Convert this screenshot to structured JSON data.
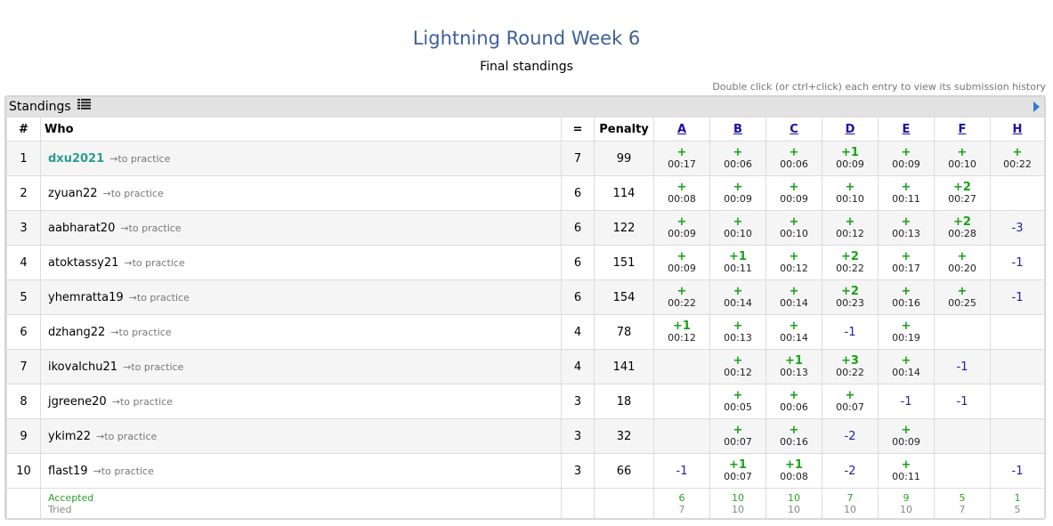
{
  "title": "Lightning Round Week 6",
  "subtitle": "Final standings",
  "hint": "Double click (or ctrl+click) each entry to view its submission history",
  "panel": {
    "label": "Standings",
    "icon": "list-icon",
    "expand_icon": "expand-arrow-icon"
  },
  "headers": {
    "rank": "#",
    "who": "Who",
    "solved": "=",
    "penalty": "Penalty"
  },
  "problems": [
    "A",
    "B",
    "C",
    "D",
    "E",
    "F",
    "H"
  ],
  "practice_label": "→to practice",
  "rows": [
    {
      "rank": "1",
      "user": "dxu2021",
      "solved": "7",
      "penalty": "99",
      "cells": [
        {
          "r": "+",
          "t": "00:17"
        },
        {
          "r": "+",
          "t": "00:06"
        },
        {
          "r": "+",
          "t": "00:06"
        },
        {
          "r": "+1",
          "t": "00:09"
        },
        {
          "r": "+",
          "t": "00:09"
        },
        {
          "r": "+",
          "t": "00:10"
        },
        {
          "r": "+",
          "t": "00:22"
        }
      ]
    },
    {
      "rank": "2",
      "user": "zyuan22",
      "solved": "6",
      "penalty": "114",
      "cells": [
        {
          "r": "+",
          "t": "00:08"
        },
        {
          "r": "+",
          "t": "00:09"
        },
        {
          "r": "+",
          "t": "00:09"
        },
        {
          "r": "+",
          "t": "00:10"
        },
        {
          "r": "+",
          "t": "00:11"
        },
        {
          "r": "+2",
          "t": "00:27"
        },
        {
          "r": "",
          "t": ""
        }
      ]
    },
    {
      "rank": "3",
      "user": "aabharat20",
      "solved": "6",
      "penalty": "122",
      "cells": [
        {
          "r": "+",
          "t": "00:09"
        },
        {
          "r": "+",
          "t": "00:10"
        },
        {
          "r": "+",
          "t": "00:10"
        },
        {
          "r": "+",
          "t": "00:12"
        },
        {
          "r": "+",
          "t": "00:13"
        },
        {
          "r": "+2",
          "t": "00:28"
        },
        {
          "r": "-3",
          "t": ""
        }
      ]
    },
    {
      "rank": "4",
      "user": "atoktassy21",
      "solved": "6",
      "penalty": "151",
      "cells": [
        {
          "r": "+",
          "t": "00:09"
        },
        {
          "r": "+1",
          "t": "00:11"
        },
        {
          "r": "+",
          "t": "00:12"
        },
        {
          "r": "+2",
          "t": "00:22"
        },
        {
          "r": "+",
          "t": "00:17"
        },
        {
          "r": "+",
          "t": "00:20"
        },
        {
          "r": "-1",
          "t": ""
        }
      ]
    },
    {
      "rank": "5",
      "user": "yhemratta19",
      "solved": "6",
      "penalty": "154",
      "cells": [
        {
          "r": "+",
          "t": "00:22"
        },
        {
          "r": "+",
          "t": "00:14"
        },
        {
          "r": "+",
          "t": "00:14"
        },
        {
          "r": "+2",
          "t": "00:23"
        },
        {
          "r": "+",
          "t": "00:16"
        },
        {
          "r": "+",
          "t": "00:25"
        },
        {
          "r": "-1",
          "t": ""
        }
      ]
    },
    {
      "rank": "6",
      "user": "dzhang22",
      "solved": "4",
      "penalty": "78",
      "cells": [
        {
          "r": "+1",
          "t": "00:12"
        },
        {
          "r": "+",
          "t": "00:13"
        },
        {
          "r": "+",
          "t": "00:14"
        },
        {
          "r": "-1",
          "t": ""
        },
        {
          "r": "+",
          "t": "00:19"
        },
        {
          "r": "",
          "t": ""
        },
        {
          "r": "",
          "t": ""
        }
      ]
    },
    {
      "rank": "7",
      "user": "ikovalchu21",
      "solved": "4",
      "penalty": "141",
      "cells": [
        {
          "r": "",
          "t": ""
        },
        {
          "r": "+",
          "t": "00:12"
        },
        {
          "r": "+1",
          "t": "00:13"
        },
        {
          "r": "+3",
          "t": "00:22"
        },
        {
          "r": "+",
          "t": "00:14"
        },
        {
          "r": "-1",
          "t": ""
        },
        {
          "r": "",
          "t": ""
        }
      ]
    },
    {
      "rank": "8",
      "user": "jgreene20",
      "solved": "3",
      "penalty": "18",
      "cells": [
        {
          "r": "",
          "t": ""
        },
        {
          "r": "+",
          "t": "00:05"
        },
        {
          "r": "+",
          "t": "00:06"
        },
        {
          "r": "+",
          "t": "00:07"
        },
        {
          "r": "-1",
          "t": ""
        },
        {
          "r": "-1",
          "t": ""
        },
        {
          "r": "",
          "t": ""
        }
      ]
    },
    {
      "rank": "9",
      "user": "ykim22",
      "solved": "3",
      "penalty": "32",
      "cells": [
        {
          "r": "",
          "t": ""
        },
        {
          "r": "+",
          "t": "00:07"
        },
        {
          "r": "+",
          "t": "00:16"
        },
        {
          "r": "-2",
          "t": ""
        },
        {
          "r": "+",
          "t": "00:09"
        },
        {
          "r": "",
          "t": ""
        },
        {
          "r": "",
          "t": ""
        }
      ]
    },
    {
      "rank": "10",
      "user": "flast19",
      "solved": "3",
      "penalty": "66",
      "cells": [
        {
          "r": "-1",
          "t": ""
        },
        {
          "r": "+1",
          "t": "00:07"
        },
        {
          "r": "+1",
          "t": "00:08"
        },
        {
          "r": "-2",
          "t": ""
        },
        {
          "r": "+",
          "t": "00:11"
        },
        {
          "r": "",
          "t": ""
        },
        {
          "r": "-1",
          "t": ""
        }
      ]
    }
  ],
  "footer": {
    "accepted_label": "Accepted",
    "tried_label": "Tried",
    "accepted": [
      "6",
      "10",
      "10",
      "7",
      "9",
      "5",
      "1"
    ],
    "tried": [
      "7",
      "10",
      "10",
      "10",
      "10",
      "7",
      "5"
    ]
  },
  "colors": {
    "title": "#3e5f99",
    "accepted": "#17a217",
    "rejected": "#1f1fa8",
    "leader": "#2a9d8f",
    "header_bar": "#e2e2e2"
  }
}
